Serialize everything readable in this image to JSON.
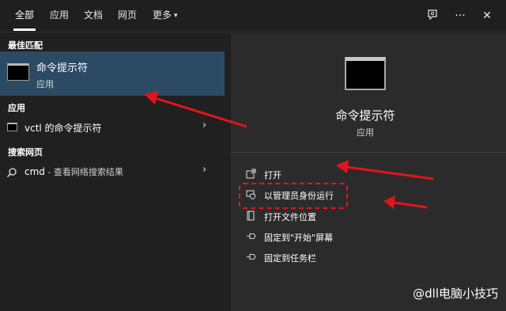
{
  "tabs": [
    {
      "label": "全部",
      "active": true
    },
    {
      "label": "应用",
      "active": false
    },
    {
      "label": "文档",
      "active": false
    },
    {
      "label": "网页",
      "active": false
    },
    {
      "label": "更多",
      "active": false
    }
  ],
  "toolbar_icons": [
    "feedback-icon",
    "more-options-icon",
    "close-icon"
  ],
  "toolbar_glyphs": {
    "more": "···",
    "close": "✕",
    "caret": "▾",
    "chevron": "›"
  },
  "left": {
    "best_match_header": "最佳匹配",
    "best_match": {
      "title": "命令提示符",
      "subtitle": "应用"
    },
    "apps_header": "应用",
    "apps": [
      {
        "label": "vctl 的命令提示符"
      }
    ],
    "web_header": "搜索网页",
    "web": {
      "query": "cmd",
      "suffix": " - 查看网络搜索结果"
    }
  },
  "preview": {
    "title": "命令提示符",
    "subtitle": "应用",
    "actions": [
      {
        "label": "打开",
        "icon": "open-icon"
      },
      {
        "label": "以管理员身份运行",
        "icon": "shield-icon"
      },
      {
        "label": "打开文件位置",
        "icon": "folder-icon"
      },
      {
        "label": "固定到\"开始\"屏幕",
        "icon": "pin-icon"
      },
      {
        "label": "固定到任务栏",
        "icon": "pin-taskbar-icon"
      }
    ]
  },
  "annotation_color": "#e0141e",
  "accent_selected_bg": "#2c4a63",
  "watermark": "@dll电脑小技巧"
}
